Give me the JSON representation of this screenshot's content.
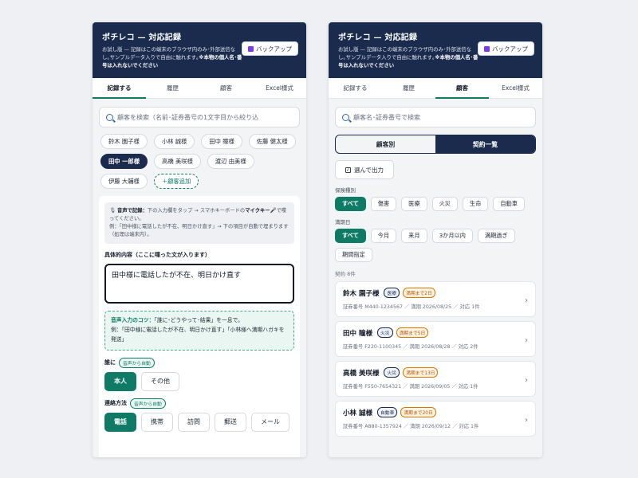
{
  "left": {
    "header": {
      "title": "ポチレコ — 対応記録",
      "subtitle_pre": "お試し版 — 記録はこの端末のブラウザ内のみ･外部送信なし｡サンプルデータ入りで自由に触れます｡",
      "subtitle_bold": "※本物の個人名･番号は入れないでください",
      "backup_label": "バックアップ"
    },
    "tabs": [
      "記録する",
      "履歴",
      "顧客",
      "Excel様式"
    ],
    "search_placeholder": "顧客を検索（名前･証券番号の1文字目から絞り込",
    "customers": [
      "鈴木 園子様",
      "小林 誠様",
      "田中 瞳様",
      "佐藤 健太様",
      "田中 一郎様",
      "高橋 美咲様",
      "渡辺 由美様",
      "伊藤 大輔様"
    ],
    "add_customer": "＋顧客追加",
    "note": {
      "mic_icon": "🎙",
      "line1_pre": "音声で記録：",
      "line1_text": "下の入力欄をタップ → スマホキーボードの",
      "line1_mic": "マイクキー🎤",
      "line1_post": "で喋ってください。",
      "line2": "例：「田中様に電話したが不在、明日かけ直す」→ 下の項目が自動で埋まります（処理は端末内）。"
    },
    "content_label": "具体的内容（ここに喋った文が入ります）",
    "content_value": "田中様に電話したが不在、明日かけ直す",
    "tip": {
      "head": "音声入力のコツ：",
      "line1": "「誰に･どうやって･結果」を一息で。",
      "line2": "例：「田中様に電話したが不在、明日かけ直す」「小林様へ満期ハガキを発送」"
    },
    "who_label": "誰に",
    "auto_badge": "音声から自動",
    "who_options": [
      "本人",
      "その他"
    ],
    "method_label": "連絡方法",
    "method_options": [
      "電話",
      "携帯",
      "訪問",
      "郵送",
      "メール"
    ]
  },
  "right": {
    "header": {
      "title": "ポチレコ — 対応記録",
      "subtitle_pre": "お試し版 — 記録はこの端末のブラウザ内のみ･外部送信なし｡サンプルデータ入りで自由に触れます｡",
      "subtitle_bold": "※本物の個人名･番号は入れないでください",
      "backup_label": "バックアップ"
    },
    "tabs": [
      "記録する",
      "履歴",
      "顧客",
      "Excel様式"
    ],
    "search_placeholder": "顧客名･証券番号で検索",
    "segments": [
      "顧客別",
      "契約一覧"
    ],
    "output_label": "選んで出力",
    "checkbox_mark": "✓",
    "insurance_label": "保険種別",
    "insurance_options": [
      "すべて",
      "傷害",
      "医療",
      "火災",
      "生命",
      "自動車"
    ],
    "expiry_label": "満期日",
    "expiry_options": [
      "すべて",
      "今月",
      "来月",
      "3か月以内",
      "満期過ぎ",
      "期間指定"
    ],
    "count_label": "契約 8件",
    "contracts": [
      {
        "name": "鈴木 園子様",
        "type": "医療",
        "due": "満期まで2日",
        "policy": "証券番号 M440-1234567",
        "expiry": "満期 2026/08/25",
        "action": "対応 1件"
      },
      {
        "name": "田中 瞳様",
        "type": "火災",
        "due": "満期まで5日",
        "policy": "証券番号 F220-1100345",
        "expiry": "満期 2026/08/28",
        "action": "対応 2件"
      },
      {
        "name": "高橋 美咲様",
        "type": "火災",
        "due": "満期まで13日",
        "policy": "証券番号 F550-7654321",
        "expiry": "満期 2026/09/05",
        "action": "対応 1件"
      },
      {
        "name": "小林 誠様",
        "type": "自動車",
        "due": "満期まで20日",
        "policy": "証券番号 A880-1357924",
        "expiry": "満期 2026/09/12",
        "action": "対応 1件"
      }
    ],
    "separator": "／",
    "chevron": "›"
  }
}
